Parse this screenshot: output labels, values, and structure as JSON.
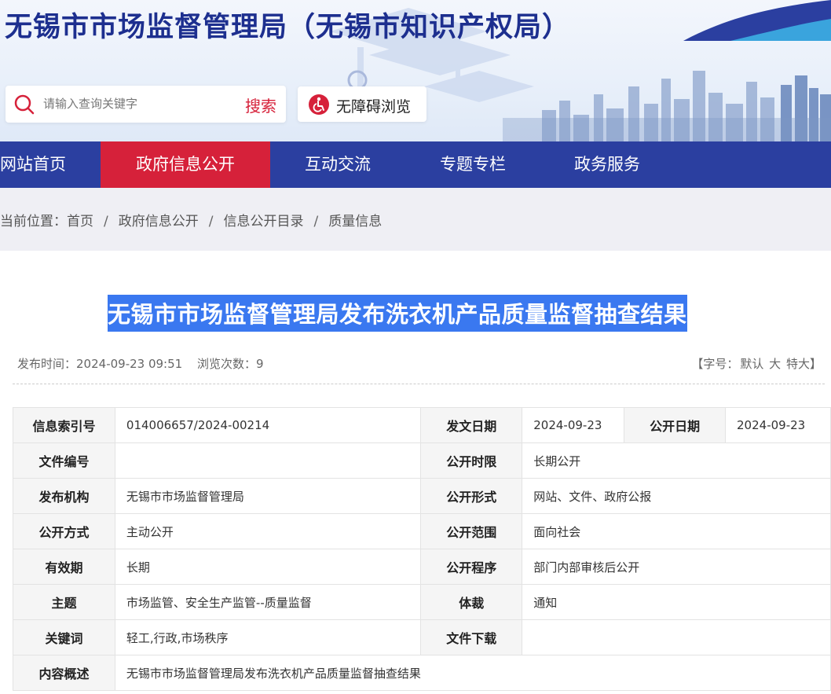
{
  "header": {
    "site_title": "无锡市市场监督管理局（无锡市知识产权局）",
    "search": {
      "placeholder": "请输入查询关键字",
      "button_label": "搜索"
    },
    "accessibility_label": "无障碍浏览"
  },
  "nav": {
    "items": [
      "网站首页",
      "政府信息公开",
      "互动交流",
      "专题专栏",
      "政务服务"
    ],
    "active_index": 1
  },
  "breadcrumb": {
    "prefix": "当前位置：",
    "items": [
      "首页",
      "政府信息公开",
      "信息公开目录",
      "质量信息"
    ],
    "separator": "/"
  },
  "article": {
    "title": "无锡市市场监督管理局发布洗衣机产品质量监督抽查结果",
    "publish_time_label": "发布时间：",
    "publish_time": "2024-09-23 09:51",
    "views_label": "浏览次数：",
    "views": "9",
    "font_size": {
      "prefix": "【字号：",
      "options": [
        "默认",
        "大",
        "特大"
      ],
      "suffix": "】"
    }
  },
  "info_table": {
    "index_no_label": "信息索引号",
    "index_no": "014006657/2024-00214",
    "issue_date_label": "发文日期",
    "issue_date": "2024-09-23",
    "public_date_label": "公开日期",
    "public_date": "2024-09-23",
    "doc_no_label": "文件编号",
    "doc_no": "",
    "public_term_label": "公开时限",
    "public_term": "长期公开",
    "publisher_label": "发布机构",
    "publisher": "无锡市市场监督管理局",
    "public_form_label": "公开形式",
    "public_form": "网站、文件、政府公报",
    "public_mode_label": "公开方式",
    "public_mode": "主动公开",
    "public_scope_label": "公开范围",
    "public_scope": "面向社会",
    "validity_label": "有效期",
    "validity": "长期",
    "public_procedure_label": "公开程序",
    "public_procedure": "部门内部审核后公开",
    "subject_label": "主题",
    "subject": "市场监管、安全生产监管--质量监督",
    "genre_label": "体裁",
    "genre": "通知",
    "keywords_label": "关键词",
    "keywords": "轻工,行政,市场秩序",
    "download_label": "文件下载",
    "download": "",
    "summary_label": "内容概述",
    "summary": "无锡市市场监督管理局发布洗衣机产品质量监督抽查结果"
  },
  "colors": {
    "brand_blue": "#2b3fa0",
    "accent_red": "#d6213a",
    "title_highlight": "#3a78f0"
  }
}
